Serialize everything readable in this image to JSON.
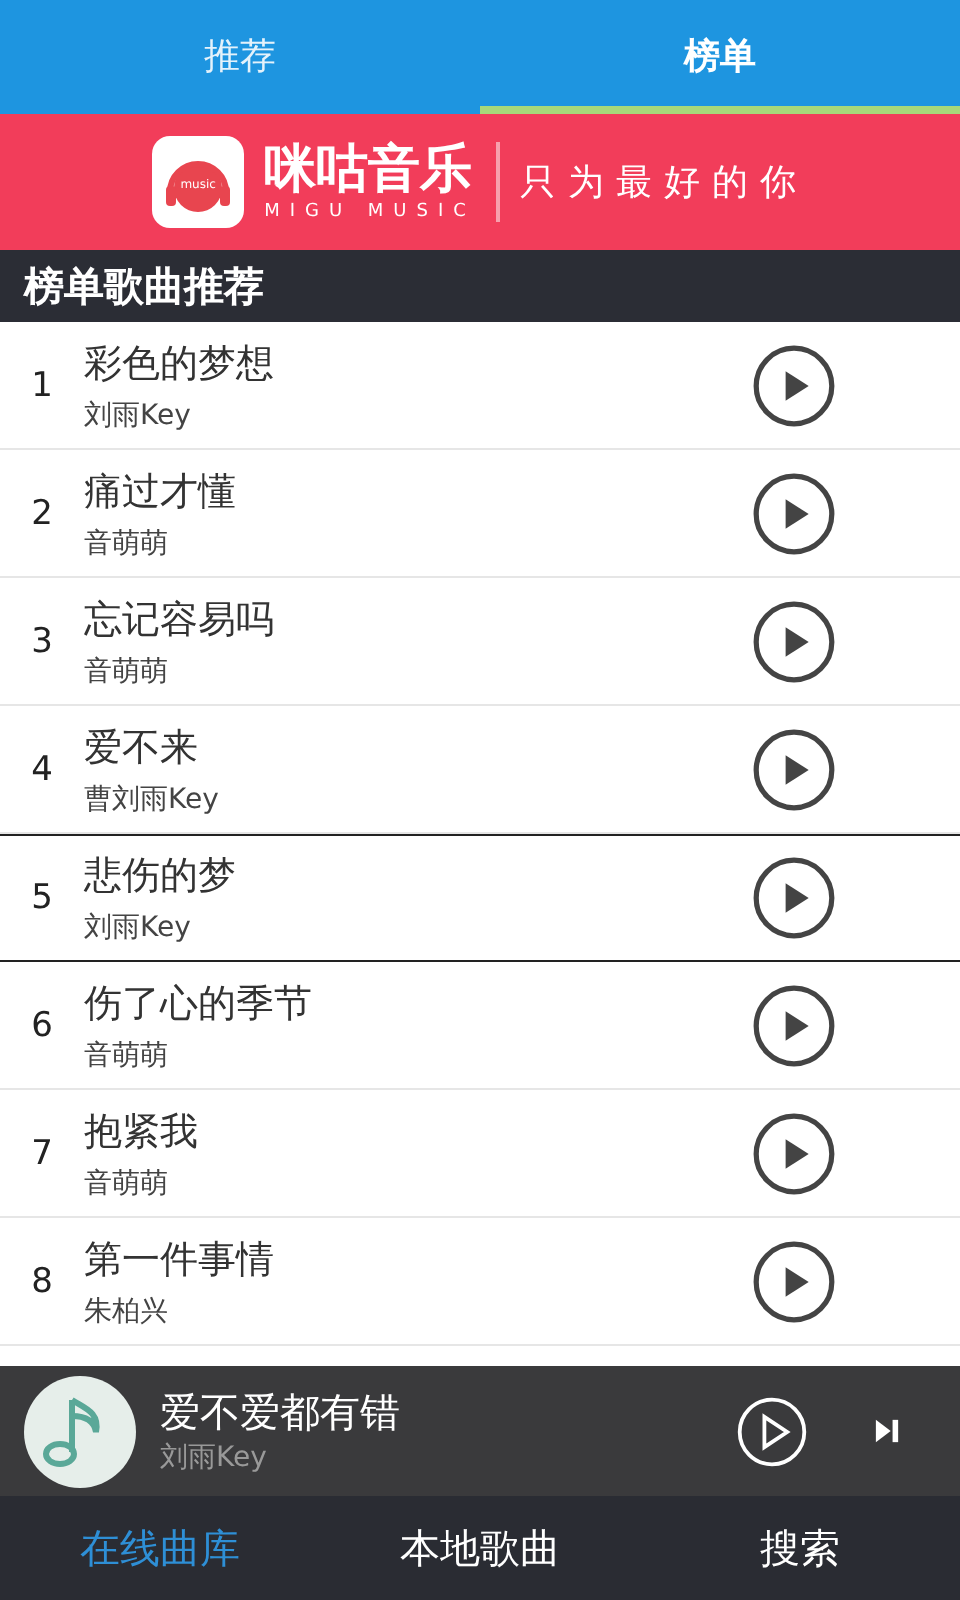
{
  "tabs": [
    {
      "label": "推荐",
      "selected": false
    },
    {
      "label": "榜单",
      "selected": true
    }
  ],
  "banner": {
    "brand": "咪咕音乐",
    "brand_latin": "MIGU MUSIC",
    "slogan": "只为最好的你",
    "logo_text": "music"
  },
  "section_title": "榜单歌曲推荐",
  "songs": [
    {
      "rank": "1",
      "title": "彩色的梦想",
      "artist": "刘雨Key",
      "selected": false
    },
    {
      "rank": "2",
      "title": "痛过才懂",
      "artist": "音萌萌",
      "selected": false
    },
    {
      "rank": "3",
      "title": "忘记容易吗",
      "artist": "音萌萌",
      "selected": false
    },
    {
      "rank": "4",
      "title": "爱不来",
      "artist": "曹刘雨Key",
      "selected": false
    },
    {
      "rank": "5",
      "title": "悲伤的梦",
      "artist": "刘雨Key",
      "selected": true
    },
    {
      "rank": "6",
      "title": "伤了心的季节",
      "artist": "音萌萌",
      "selected": false
    },
    {
      "rank": "7",
      "title": "抱紧我",
      "artist": "音萌萌",
      "selected": false
    },
    {
      "rank": "8",
      "title": "第一件事情",
      "artist": "朱柏兴",
      "selected": false
    }
  ],
  "player": {
    "title": "爱不爱都有错",
    "artist": "刘雨Key"
  },
  "nav": [
    {
      "label": "在线曲库",
      "selected": true
    },
    {
      "label": "本地歌曲",
      "selected": false
    },
    {
      "label": "搜索",
      "selected": false
    }
  ]
}
